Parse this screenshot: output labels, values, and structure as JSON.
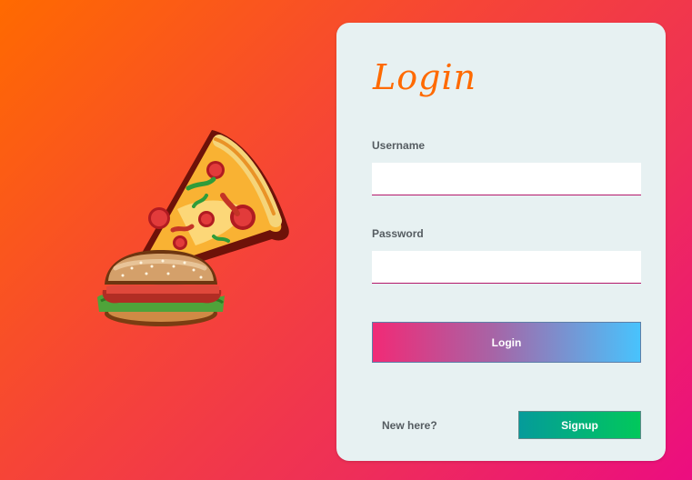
{
  "login_card": {
    "title": "Login",
    "username_label": "Username",
    "username_value": "",
    "password_label": "Password",
    "password_value": "",
    "login_button": "Login",
    "new_here_text": "New here?",
    "signup_button": "Signup"
  },
  "illustration": {
    "icon": "pizza-burger-icon"
  },
  "colors": {
    "background_gradient": [
      "#ff6a00",
      "#ec0d80"
    ],
    "card_background": "#e7f1f2",
    "title": "#ff6a00",
    "login_button_gradient": [
      "#f12a76",
      "#48c3fd"
    ],
    "signup_button_gradient": [
      "#059b9a",
      "#01c85b"
    ],
    "input_underline": "#b3186a"
  }
}
